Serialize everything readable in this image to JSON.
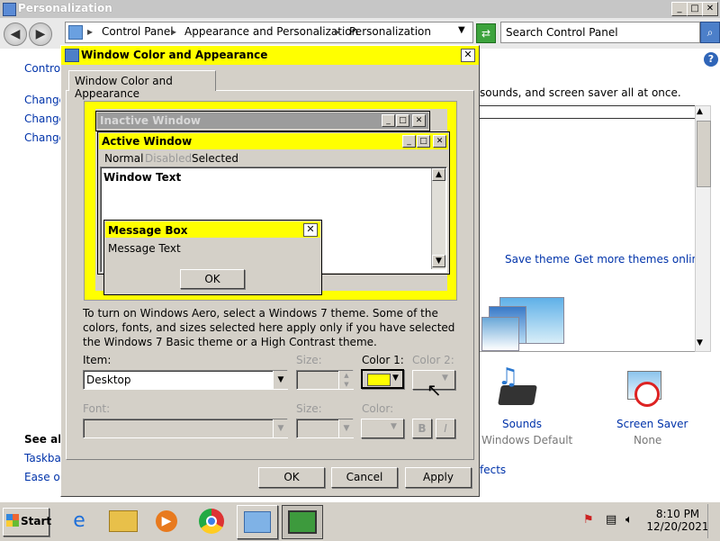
{
  "outer_window": {
    "title": "Personalization",
    "min_label": "_",
    "max_label": "□",
    "close_label": "✕",
    "address": {
      "back_label": "◀",
      "forward_label": "▶",
      "crumbs": [
        "Control Panel",
        "Appearance and Personalization",
        "Personalization"
      ],
      "separator": "▸"
    },
    "search_placeholder": "Search Control Panel",
    "help_label": "?",
    "left_links": [
      "Control",
      "Change",
      "Change",
      "Change"
    ],
    "see_also": "See als",
    "see_also_links": [
      "Taskbar",
      "Ease of"
    ],
    "intro_tail": "sounds, and screen saver all at once.",
    "save_theme": "Save theme",
    "get_more": "Get more themes online",
    "sounds": {
      "label": "Sounds",
      "sub": "Windows Default"
    },
    "screensaver": {
      "label": "Screen Saver",
      "sub": "None"
    },
    "effects_tail": "fects"
  },
  "dialog": {
    "title": "Window Color and Appearance",
    "close_label": "✕",
    "tab": "Window Color and Appearance",
    "preview": {
      "inactive_title": "Inactive Window",
      "active_title": "Active Window",
      "menu": {
        "normal": "Normal",
        "disabled": "Disabled",
        "selected": "Selected"
      },
      "window_text": "Window Text",
      "message_box_title": "Message Box",
      "message_text": "Message Text",
      "ok": "OK"
    },
    "info": "To turn on Windows Aero, select a Windows 7 theme.  Some of the colors, fonts, and sizes selected here apply only if you have selected the Windows 7 Basic theme or a High Contrast theme.",
    "item_label": "Item:",
    "item_value": "Desktop",
    "size_label": "Size:",
    "color1_label": "Color 1:",
    "color2_label": "Color 2:",
    "font_label": "Font:",
    "size2_label": "Size:",
    "color_label": "Color:",
    "bold_label": "B",
    "italic_label": "I",
    "ok": "OK",
    "cancel": "Cancel",
    "apply": "Apply"
  },
  "colors": {
    "accent": "#ffff00"
  },
  "taskbar": {
    "start": "Start",
    "time": "8:10 PM",
    "date": "12/20/2021",
    "icons": [
      "ie-icon",
      "explorer-icon",
      "media-player-icon",
      "chrome-icon",
      "control-panel-icon",
      "personalization-icon"
    ]
  }
}
